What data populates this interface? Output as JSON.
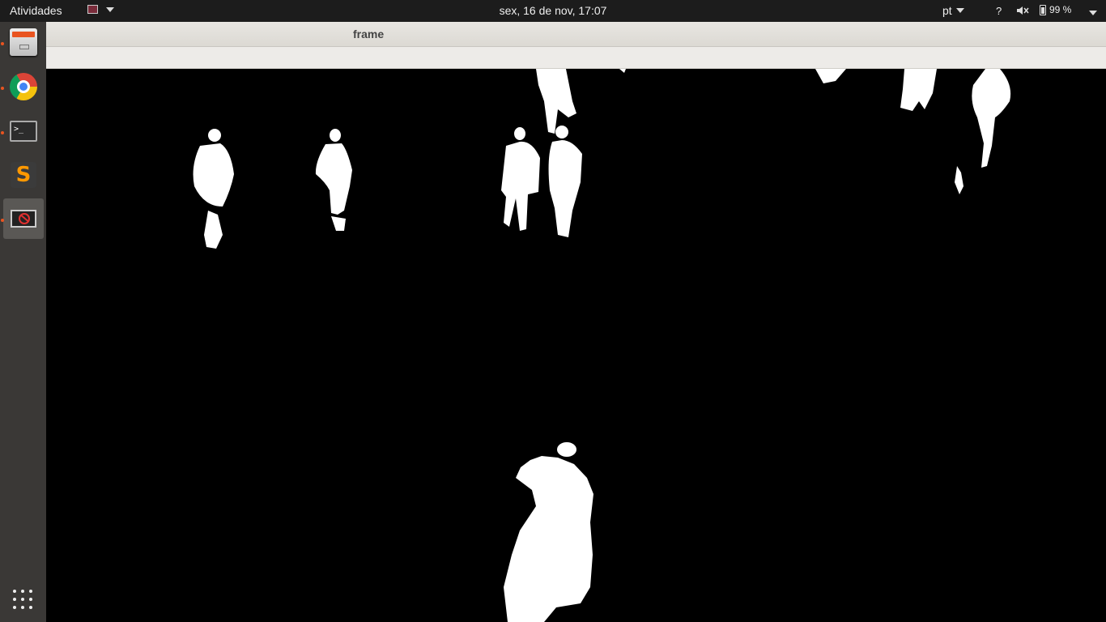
{
  "topbar": {
    "activities": "Atividades",
    "clock": "sex, 16 de nov, 17:07",
    "language": "pt",
    "help": "?",
    "battery": "99 %"
  },
  "dock": {
    "items": [
      "files",
      "chrome",
      "terminal",
      "sublime-text",
      "frame-window"
    ]
  },
  "window": {
    "title": "frame"
  },
  "colors": {
    "topbar_bg": "#1c1c1c",
    "dock_bg": "#3a3836",
    "accent": "#e95420"
  }
}
